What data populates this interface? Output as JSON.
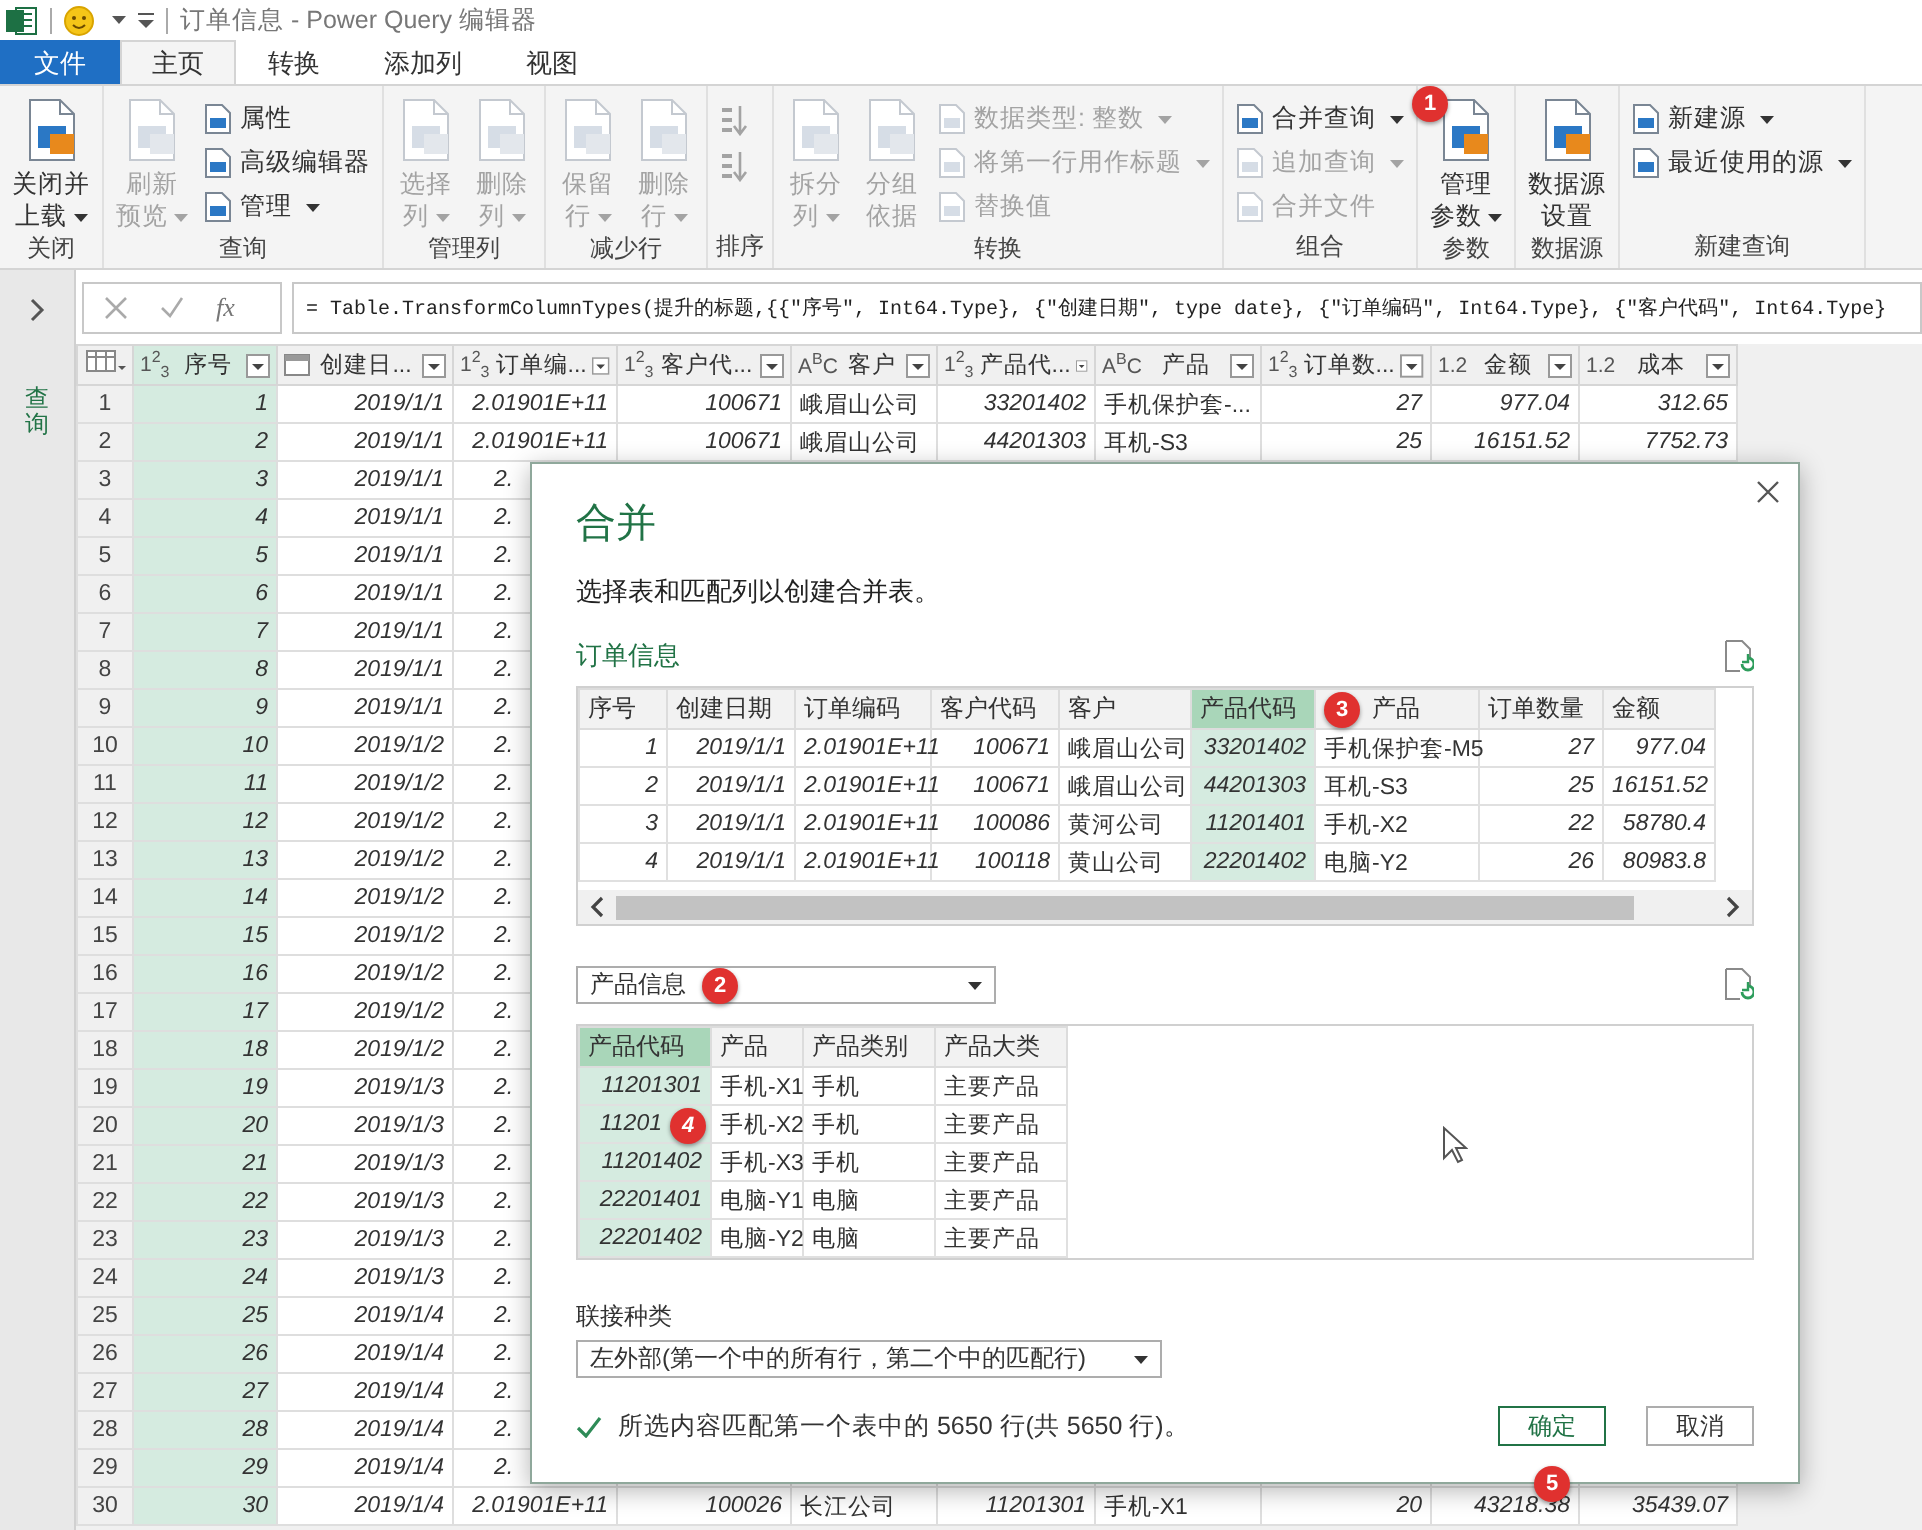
{
  "title_bar": {
    "title": "订单信息 - Power Query 编辑器"
  },
  "tabs": [
    {
      "label": "文件",
      "kind": "file",
      "selected": false
    },
    {
      "label": "主页",
      "kind": "tab",
      "selected": true
    },
    {
      "label": "转换",
      "kind": "tab",
      "selected": false
    },
    {
      "label": "添加列",
      "kind": "tab",
      "selected": false
    },
    {
      "label": "视图",
      "kind": "tab",
      "selected": false
    }
  ],
  "ribbon": {
    "groups": [
      {
        "label": "关闭",
        "items": [
          {
            "kind": "large",
            "lines": [
              "关闭并",
              "上载"
            ],
            "dropdown": true,
            "disabled": false
          }
        ]
      },
      {
        "label": "查询",
        "items": [
          {
            "kind": "large",
            "lines": [
              "刷新",
              "预览"
            ],
            "dropdown": true,
            "disabled": true
          },
          {
            "kind": "small",
            "lines": [
              "属性"
            ],
            "dropdown": false,
            "disabled": false
          },
          {
            "kind": "small",
            "lines": [
              "高级编辑器"
            ],
            "dropdown": false,
            "disabled": false
          },
          {
            "kind": "small",
            "lines": [
              "管理"
            ],
            "dropdown": true,
            "disabled": false
          }
        ]
      },
      {
        "label": "管理列",
        "items": [
          {
            "kind": "large",
            "lines": [
              "选择",
              "列"
            ],
            "dropdown": true,
            "disabled": true
          },
          {
            "kind": "large",
            "lines": [
              "删除",
              "列"
            ],
            "dropdown": true,
            "disabled": true
          }
        ]
      },
      {
        "label": "减少行",
        "items": [
          {
            "kind": "large",
            "lines": [
              "保留",
              "行"
            ],
            "dropdown": true,
            "disabled": true
          },
          {
            "kind": "large",
            "lines": [
              "删除",
              "行"
            ],
            "dropdown": true,
            "disabled": true
          }
        ]
      },
      {
        "label": "排序",
        "items": [
          {
            "kind": "sort",
            "disabled": true
          },
          {
            "kind": "sort",
            "disabled": true
          }
        ]
      },
      {
        "label": "转换",
        "items": [
          {
            "kind": "large",
            "lines": [
              "拆分",
              "列"
            ],
            "dropdown": true,
            "disabled": true
          },
          {
            "kind": "large",
            "lines": [
              "分组",
              "依据"
            ],
            "dropdown": false,
            "disabled": true
          },
          {
            "kind": "small",
            "lines": [
              "数据类型: 整数"
            ],
            "dropdown": true,
            "disabled": true
          },
          {
            "kind": "small",
            "lines": [
              "将第一行用作标题"
            ],
            "dropdown": true,
            "disabled": true
          },
          {
            "kind": "small",
            "lines": [
              "替换值"
            ],
            "dropdown": false,
            "disabled": true
          }
        ]
      },
      {
        "label": "组合",
        "items": [
          {
            "kind": "small",
            "lines": [
              "合并查询"
            ],
            "dropdown": true,
            "disabled": false,
            "callout": "1"
          },
          {
            "kind": "small",
            "lines": [
              "追加查询"
            ],
            "dropdown": true,
            "disabled": true
          },
          {
            "kind": "small",
            "lines": [
              "合并文件"
            ],
            "dropdown": false,
            "disabled": true
          }
        ]
      },
      {
        "label": "参数",
        "items": [
          {
            "kind": "large",
            "lines": [
              "管理",
              "参数"
            ],
            "dropdown": true,
            "disabled": false
          }
        ]
      },
      {
        "label": "数据源",
        "items": [
          {
            "kind": "large",
            "lines": [
              "数据源",
              "设置"
            ],
            "dropdown": false,
            "disabled": false
          }
        ]
      },
      {
        "label": "新建查询",
        "items": [
          {
            "kind": "small",
            "lines": [
              "新建源"
            ],
            "dropdown": true,
            "disabled": false
          },
          {
            "kind": "small",
            "lines": [
              "最近使用的源"
            ],
            "dropdown": true,
            "disabled": false
          }
        ]
      }
    ]
  },
  "queries_panel": {
    "label": "查询"
  },
  "formula_bar": {
    "function_label": "fx",
    "formula": "= Table.TransformColumnTypes(提升的标题,{{\"序号\", Int64.Type}, {\"创建日期\", type date}, {\"订单编码\", Int64.Type}, {\"客户代码\", Int64.Type}"
  },
  "grid": {
    "columns": [
      {
        "label": "序号",
        "kind": "number",
        "type_label": "1$^{2}$$_{3}$",
        "selected": true
      },
      {
        "label": "创建日...",
        "kind": "date",
        "selected": false
      },
      {
        "label": "订单编...",
        "kind": "number",
        "type_label": "1$^{2}$$_{3}$",
        "selected": false
      },
      {
        "label": "客户代...",
        "kind": "number",
        "type_label": "1$^{2}$$_{3}$",
        "selected": false
      },
      {
        "label": "客户",
        "kind": "text",
        "type_label": "A$^{B}$C",
        "selected": false
      },
      {
        "label": "产品代...",
        "kind": "number",
        "type_label": "1$^{2}$$_{3}$",
        "selected": false
      },
      {
        "label": "产品",
        "kind": "text",
        "type_label": "A$^{B}$C",
        "selected": false
      },
      {
        "label": "订单数...",
        "kind": "number",
        "type_label": "1$^{2}$$_{3}$",
        "selected": false
      },
      {
        "label": "金额",
        "kind": "number",
        "type_label": "1.2",
        "selected": false
      },
      {
        "label": "成本",
        "kind": "number",
        "type_label": "1.2",
        "selected": false
      }
    ],
    "rows": [
      {
        "number": "1",
        "cells": [
          "1",
          "2019/1/1",
          "2.01901E+11",
          "100671",
          "峨眉山公司",
          "33201402",
          "手机保护套-...",
          "27",
          "977.04",
          "312.65"
        ]
      },
      {
        "number": "2",
        "cells": [
          "2",
          "2019/1/1",
          "2.01901E+11",
          "100671",
          "峨眉山公司",
          "44201303",
          "耳机-S3",
          "25",
          "16151.52",
          "7752.73"
        ]
      },
      {
        "number": "3",
        "cells": [
          "3",
          "2019/1/1",
          "2."
        ]
      },
      {
        "number": "4",
        "cells": [
          "4",
          "2019/1/1",
          "2."
        ]
      },
      {
        "number": "5",
        "cells": [
          "5",
          "2019/1/1",
          "2."
        ]
      },
      {
        "number": "6",
        "cells": [
          "6",
          "2019/1/1",
          "2."
        ]
      },
      {
        "number": "7",
        "cells": [
          "7",
          "2019/1/1",
          "2."
        ]
      },
      {
        "number": "8",
        "cells": [
          "8",
          "2019/1/1",
          "2."
        ]
      },
      {
        "number": "9",
        "cells": [
          "9",
          "2019/1/1",
          "2."
        ]
      },
      {
        "number": "10",
        "cells": [
          "10",
          "2019/1/2",
          "2."
        ]
      },
      {
        "number": "11",
        "cells": [
          "11",
          "2019/1/2",
          "2."
        ]
      },
      {
        "number": "12",
        "cells": [
          "12",
          "2019/1/2",
          "2."
        ]
      },
      {
        "number": "13",
        "cells": [
          "13",
          "2019/1/2",
          "2."
        ]
      },
      {
        "number": "14",
        "cells": [
          "14",
          "2019/1/2",
          "2."
        ]
      },
      {
        "number": "15",
        "cells": [
          "15",
          "2019/1/2",
          "2."
        ]
      },
      {
        "number": "16",
        "cells": [
          "16",
          "2019/1/2",
          "2."
        ]
      },
      {
        "number": "17",
        "cells": [
          "17",
          "2019/1/2",
          "2."
        ]
      },
      {
        "number": "18",
        "cells": [
          "18",
          "2019/1/2",
          "2."
        ]
      },
      {
        "number": "19",
        "cells": [
          "19",
          "2019/1/3",
          "2."
        ]
      },
      {
        "number": "20",
        "cells": [
          "20",
          "2019/1/3",
          "2."
        ]
      },
      {
        "number": "21",
        "cells": [
          "21",
          "2019/1/3",
          "2."
        ]
      },
      {
        "number": "22",
        "cells": [
          "22",
          "2019/1/3",
          "2."
        ]
      },
      {
        "number": "23",
        "cells": [
          "23",
          "2019/1/3",
          "2."
        ]
      },
      {
        "number": "24",
        "cells": [
          "24",
          "2019/1/3",
          "2."
        ]
      },
      {
        "number": "25",
        "cells": [
          "25",
          "2019/1/4",
          "2."
        ]
      },
      {
        "number": "26",
        "cells": [
          "26",
          "2019/1/4",
          "2."
        ]
      },
      {
        "number": "27",
        "cells": [
          "27",
          "2019/1/4",
          "2."
        ]
      },
      {
        "number": "28",
        "cells": [
          "28",
          "2019/1/4",
          "2."
        ]
      },
      {
        "number": "29",
        "cells": [
          "29",
          "2019/1/4",
          "2."
        ]
      },
      {
        "number": "30",
        "cells": [
          "30",
          "2019/1/4",
          "2.01901E+11",
          "100026",
          "长江公司",
          "11201301",
          "手机-X1",
          "20",
          "43218.38",
          "35439.07"
        ]
      }
    ]
  },
  "merge_dialog": {
    "title": "合并",
    "subtitle": "选择表和匹配列以创建合并表。",
    "first_table": {
      "name": "订单信息",
      "columns": [
        {
          "label": "序号",
          "kind": "number",
          "selected": false
        },
        {
          "label": "创建日期",
          "kind": "number",
          "selected": false
        },
        {
          "label": "订单编码",
          "kind": "number",
          "selected": false
        },
        {
          "label": "客户代码",
          "kind": "number",
          "selected": false
        },
        {
          "label": "客户",
          "kind": "text",
          "selected": false
        },
        {
          "label": "产品代码",
          "kind": "number",
          "selected": true
        },
        {
          "label": "产品",
          "kind": "text",
          "selected": false,
          "callout": "3"
        },
        {
          "label": "订单数量",
          "kind": "number",
          "selected": false
        },
        {
          "label": "金额",
          "kind": "number",
          "selected": false
        }
      ],
      "rows": [
        [
          "1",
          "2019/1/1",
          "2.01901E+11",
          "100671",
          "峨眉山公司",
          "33201402",
          "手机保护套-M5",
          "27",
          "977.04"
        ],
        [
          "2",
          "2019/1/1",
          "2.01901E+11",
          "100671",
          "峨眉山公司",
          "44201303",
          "耳机-S3",
          "25",
          "16151.52"
        ],
        [
          "3",
          "2019/1/1",
          "2.01901E+11",
          "100086",
          "黄河公司",
          "11201401",
          "手机-X2",
          "22",
          "58780.4"
        ],
        [
          "4",
          "2019/1/1",
          "2.01901E+11",
          "100118",
          "黄山公司",
          "22201402",
          "电脑-Y2",
          "26",
          "80983.8"
        ]
      ]
    },
    "second_table": {
      "name": "产品信息",
      "callout": "2",
      "columns": [
        {
          "label": "产品代码",
          "kind": "number",
          "selected": true
        },
        {
          "label": "产品",
          "kind": "text",
          "selected": false
        },
        {
          "label": "产品类别",
          "kind": "text",
          "selected": false
        },
        {
          "label": "产品大类",
          "kind": "text",
          "selected": false
        }
      ],
      "rows": [
        {
          "cells": [
            "11201301",
            "手机-X1",
            "手机",
            "主要产品"
          ]
        },
        {
          "cells": [
            "11201",
            "手机-X2",
            "手机",
            "主要产品"
          ],
          "callout": "4"
        },
        {
          "cells": [
            "11201402",
            "手机-X3",
            "手机",
            "主要产品"
          ]
        },
        {
          "cells": [
            "22201401",
            "电脑-Y1",
            "电脑",
            "主要产品"
          ]
        },
        {
          "cells": [
            "22201402",
            "电脑-Y2",
            "电脑",
            "主要产品"
          ]
        }
      ]
    },
    "join_label": "联接种类",
    "join_kind": "左外部(第一个中的所有行，第二个中的匹配行)",
    "match_message": "所选内容匹配第一个表中的 5650 行(共 5650 行)。",
    "buttons": [
      {
        "label": "确定",
        "kind": "primary",
        "callout": "5"
      },
      {
        "label": "取消",
        "kind": "secondary"
      }
    ]
  }
}
